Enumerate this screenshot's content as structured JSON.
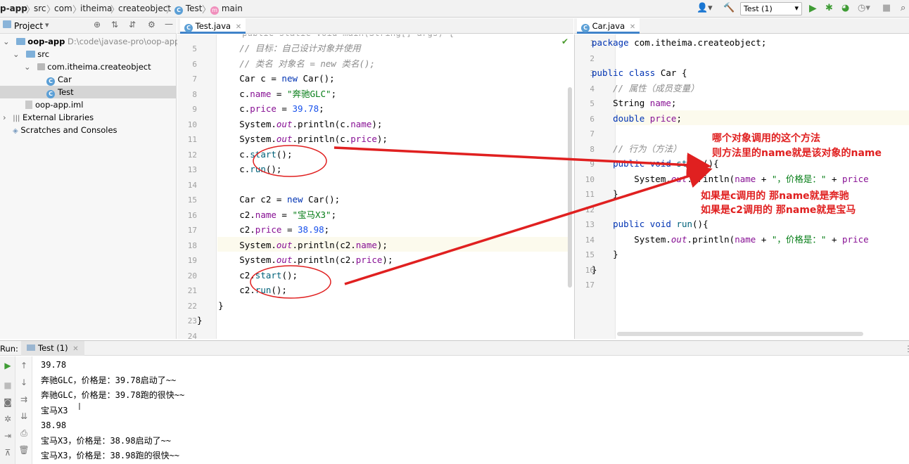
{
  "breadcrumbs": [
    "p-app",
    "src",
    "com",
    "itheima",
    "createobject",
    "Test",
    "main"
  ],
  "toolbar": {
    "run_config": "Test (1)",
    "run_config_icon": "dropdown-arrow"
  },
  "project_panel": {
    "title": "Project",
    "tree": [
      {
        "label": "oop-app",
        "hint": "D:\\code\\javase-pro\\oop-app",
        "icon": "module-folder-icon"
      },
      {
        "label": "src",
        "icon": "source-folder-icon"
      },
      {
        "label": "com.itheima.createobject",
        "icon": "package-icon"
      },
      {
        "label": "Car",
        "icon": "class-icon"
      },
      {
        "label": "Test",
        "icon": "class-icon"
      },
      {
        "label": "oop-app.iml",
        "icon": "iml-file-icon"
      },
      {
        "label": "External Libraries",
        "icon": "libraries-icon"
      },
      {
        "label": "Scratches and Consoles",
        "icon": "scratches-icon"
      }
    ]
  },
  "left_editor": {
    "tab": "Test.java",
    "top_partial": "public static void main(String[] args) {",
    "line_numbers": [
      "5",
      "6",
      "7",
      "8",
      "9",
      "10",
      "11",
      "12",
      "13",
      "14",
      "15",
      "16",
      "17",
      "18",
      "19",
      "20",
      "21",
      "22",
      "23",
      "24"
    ],
    "lines": [
      "        // 目标：自己设计对象并使用",
      "        // 类名 对象名 = new 类名();",
      "        Car c = new Car();",
      "        c.name = \"奔驰GLC\";",
      "        c.price = 39.78;",
      "        System.out.println(c.name);",
      "        System.out.println(c.price);",
      "        c.start();",
      "        c.run();",
      "",
      "        Car c2 = new Car();",
      "        c2.name = \"宝马X3\";",
      "        c2.price = 38.98;",
      "        System.out.println(c2.name);",
      "        System.out.println(c2.price);",
      "        c2.start();",
      "        c2.run();",
      "    }",
      "}",
      ""
    ]
  },
  "right_editor": {
    "tab": "Car.java",
    "line_numbers": [
      "1",
      "2",
      "3",
      "4",
      "5",
      "6",
      "7",
      "8",
      "9",
      "10",
      "11",
      "12",
      "13",
      "14",
      "15",
      "16",
      "17"
    ],
    "lines": [
      "package com.itheima.createobject;",
      "",
      "public class Car {",
      "    // 属性（成员变量）",
      "    String name;",
      "    double price;",
      "",
      "    // 行为（方法）",
      "    public void start(){",
      "        System.out.println(name + \"，价格是：\" + price",
      "    }",
      "",
      "    public void run(){",
      "        System.out.println(name + \"，价格是：\" + price",
      "    }",
      "}",
      ""
    ]
  },
  "annotations": {
    "note1_line1": "哪个对象调用的这个方法",
    "note1_line2": "则方法里的name就是该对象的name",
    "note2_line1": "如果是c调用的 那name就是奔驰",
    "note2_line2": "如果是c2调用的 那name就是宝马",
    "color": "#e02020"
  },
  "run_panel": {
    "label": "Run:",
    "tab": "Test (1)",
    "output": [
      "39.78",
      "奔驰GLC，价格是：39.78启动了~~",
      "奔驰GLC，价格是：39.78跑的很快~~",
      "宝马X3",
      "38.98",
      "宝马X3，价格是：38.98启动了~~",
      "宝马X3，价格是：38.98跑的很快~~"
    ]
  }
}
